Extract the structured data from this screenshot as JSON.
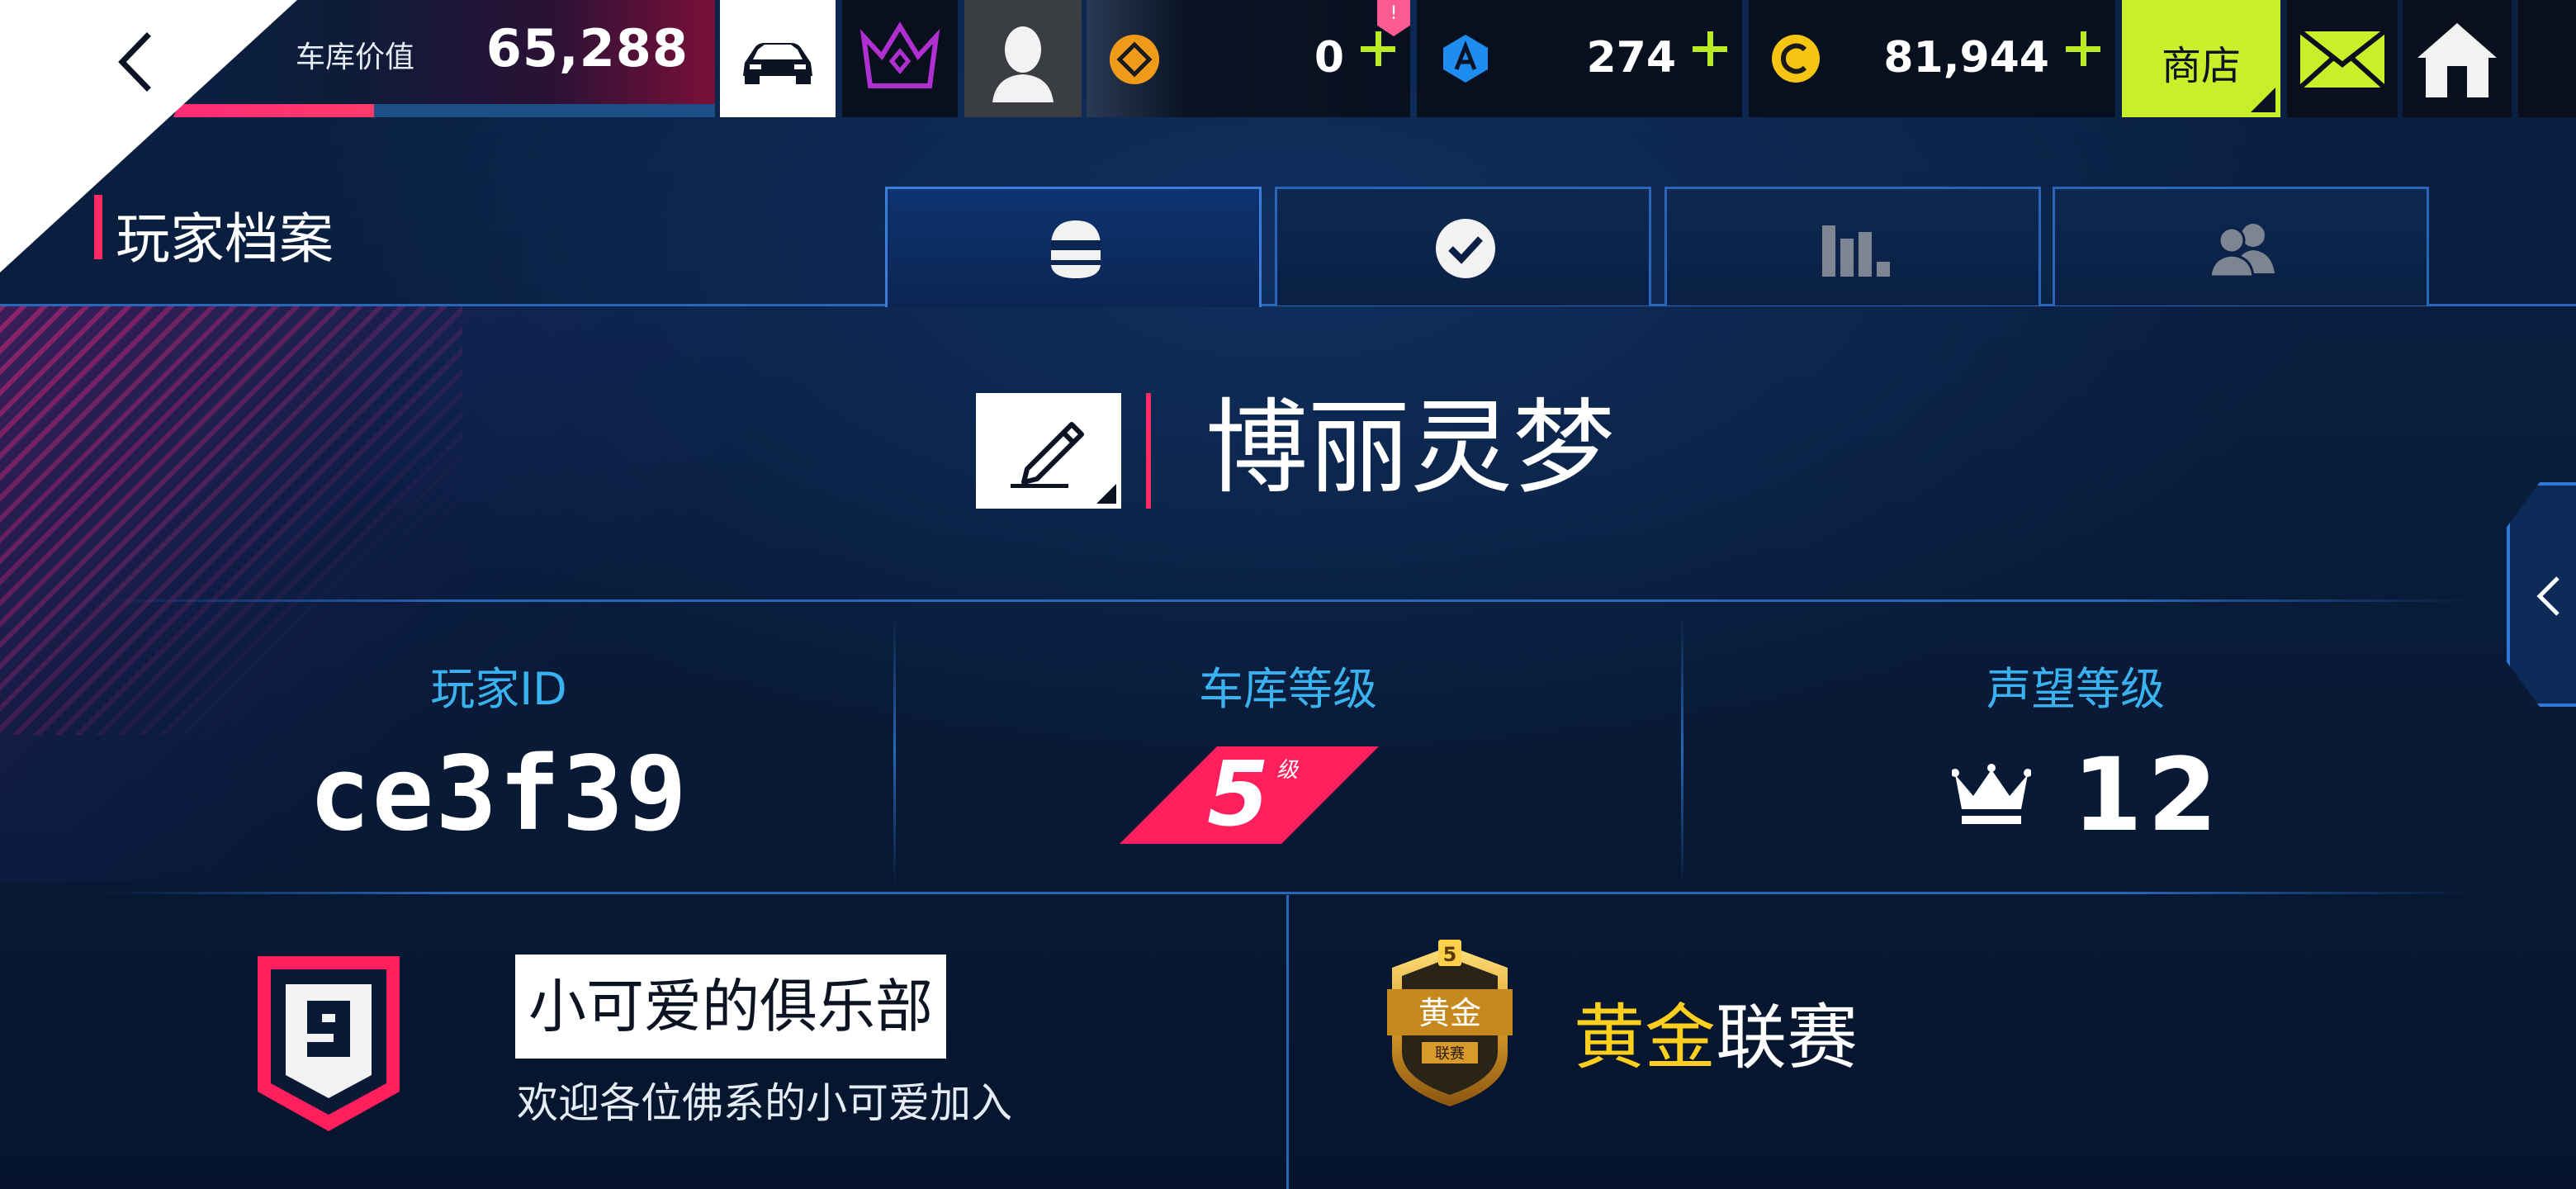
{
  "topbar": {
    "garage_value_label": "车库价值",
    "garage_value": "65,288",
    "garage_value_progress": 0.37,
    "tokens_alert": "!",
    "tokens_value": "0",
    "blueprints_value": "274",
    "credits_value": "81,944",
    "shop_label": "商店"
  },
  "header": {
    "title": "玩家档案",
    "active_tab": 1
  },
  "profile": {
    "player_name": "博丽灵梦",
    "player_id_label": "玩家ID",
    "player_id": "ce3f39",
    "garage_level_label": "车库等级",
    "garage_level": "5",
    "garage_level_unit": "级",
    "reputation_label": "声望等级",
    "reputation_level": "12"
  },
  "club": {
    "name": "小可爱的俱乐部",
    "description": "欢迎各位佛系的小可爱加入"
  },
  "league": {
    "badge_top": "黄金",
    "badge_bottom": "联赛",
    "name_highlight": "黄金",
    "name_rest": "联赛"
  },
  "colors": {
    "accent_pink": "#ff2b64",
    "accent_lime": "#c8ef2a",
    "label_blue": "#3ab2f0",
    "gold": "#ffcf1e",
    "background": "#081b38"
  },
  "icons": [
    "back-arrow-icon",
    "car-icon",
    "crown-emblem-icon",
    "avatar-icon",
    "token-icon",
    "blueprint-icon",
    "credits-icon",
    "plus-icon",
    "mail-icon",
    "home-icon",
    "helmet-icon",
    "check-icon",
    "stats-icon",
    "friends-icon",
    "pencil-icon",
    "crown-icon",
    "club-shield-icon",
    "league-badge-icon",
    "chevron-left-icon"
  ]
}
